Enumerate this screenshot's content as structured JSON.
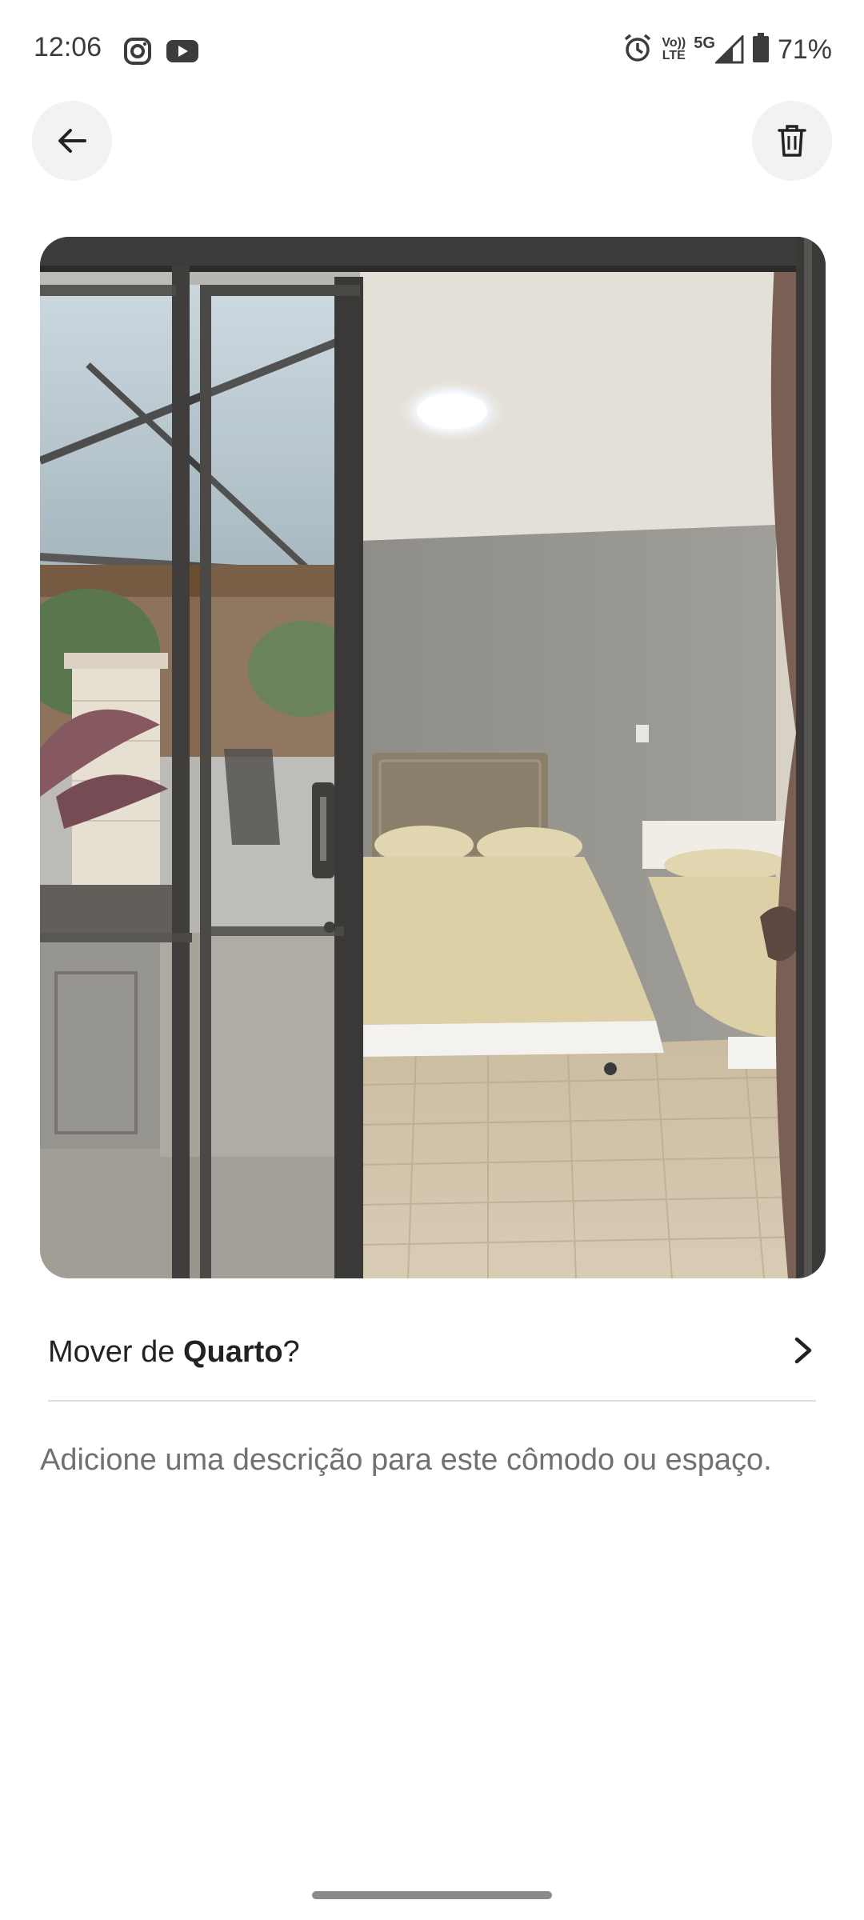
{
  "status_bar": {
    "time": "12:06",
    "network_badge_top": "Vo))",
    "network_badge_bottom": "LTE",
    "network_5g": "5G",
    "battery": "71%",
    "icons": [
      "instagram-icon",
      "youtube-icon",
      "alarm-icon",
      "volte-icon",
      "signal-icon",
      "battery-icon"
    ]
  },
  "header": {
    "back_icon": "arrow-left-icon",
    "delete_icon": "trash-icon"
  },
  "photo": {
    "subject": "bedroom-through-sliding-glass-door"
  },
  "move_row": {
    "prefix": "Mover de ",
    "room": "Quarto",
    "suffix": "?",
    "chevron_icon": "chevron-right-icon"
  },
  "description": {
    "placeholder": "Adicione uma descrição para este cômodo ou espaço."
  },
  "colors": {
    "text_primary": "#222222",
    "text_secondary": "#717171",
    "button_bg": "#f2f2f2",
    "divider": "#dddddd"
  }
}
